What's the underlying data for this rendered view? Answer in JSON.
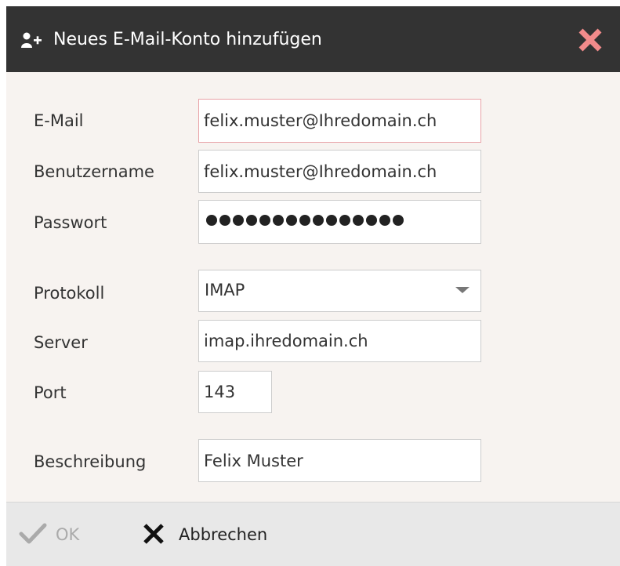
{
  "dialog": {
    "title": "Neues E-Mail-Konto hinzufügen",
    "title_icon": "add-user-icon",
    "close_icon": "close-icon",
    "accent_close_color": "#f28b8b",
    "header_color": "#333333"
  },
  "form": {
    "email": {
      "label": "E-Mail",
      "value": "felix.muster@Ihredomain.ch",
      "invalid": true
    },
    "username": {
      "label": "Benutzername",
      "value": "felix.muster@Ihredomain.ch"
    },
    "password": {
      "label": "Passwort",
      "value": "•••••••••••••••",
      "masked_length": 15
    },
    "protocol": {
      "label": "Protokoll",
      "selected": "IMAP"
    },
    "server": {
      "label": "Server",
      "value": "imap.ihredomain.ch"
    },
    "port": {
      "label": "Port",
      "value": "143"
    },
    "description": {
      "label": "Beschreibung",
      "value": "Felix Muster"
    }
  },
  "footer": {
    "ok_label": "OK",
    "ok_disabled": true,
    "ok_icon": "checkmark-icon",
    "cancel_label": "Abbrechen",
    "cancel_icon": "x-icon"
  }
}
